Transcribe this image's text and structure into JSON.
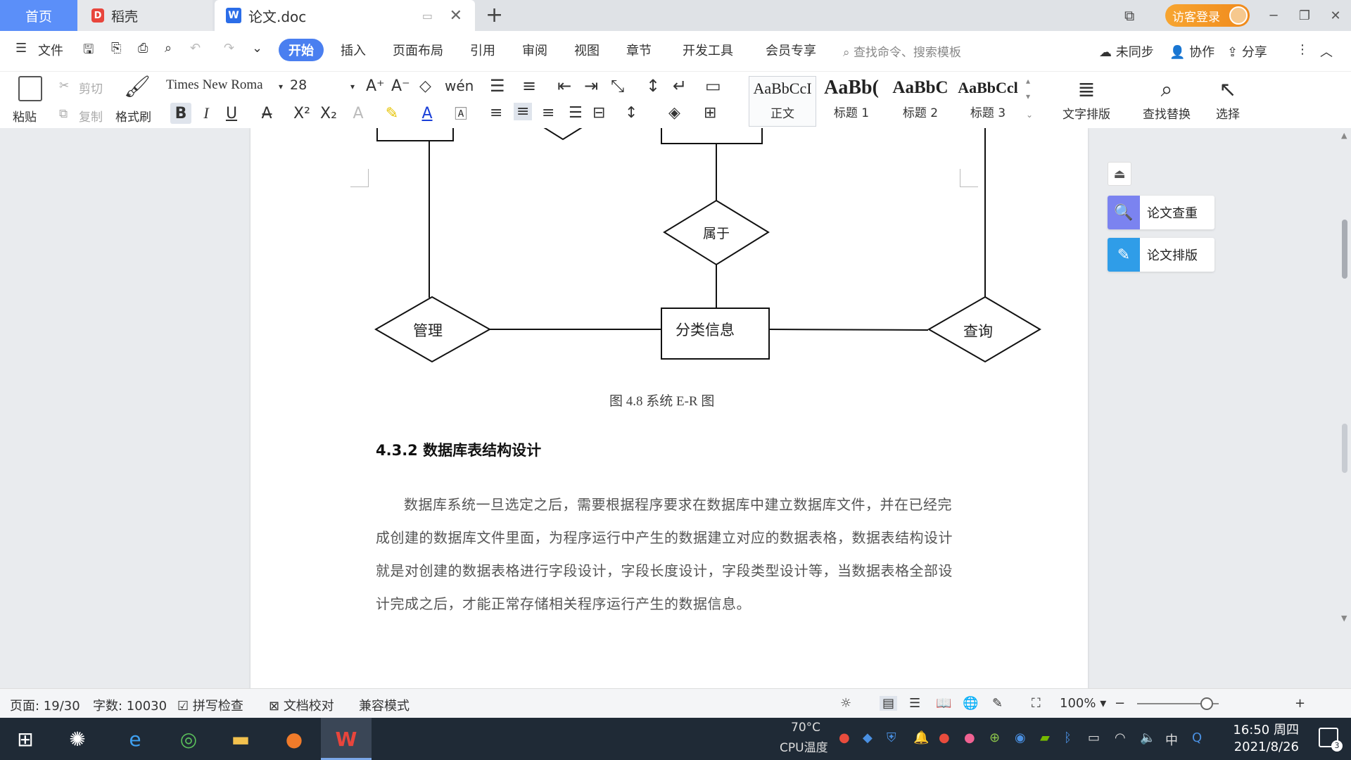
{
  "tabs": {
    "home": "首页",
    "daoke": "稻壳",
    "doc_title": "论文.doc",
    "guest_login": "访客登录"
  },
  "menu": {
    "file": "文件",
    "items": [
      "开始",
      "插入",
      "页面布局",
      "引用",
      "审阅",
      "视图",
      "章节",
      "开发工具",
      "会员专享"
    ],
    "search_placeholder": "查找命令、搜索模板",
    "sync": "未同步",
    "collab": "协作",
    "share": "分享"
  },
  "ribbon": {
    "paste": "粘贴",
    "cut": "剪切",
    "copy": "复制",
    "format_painter": "格式刷",
    "font_name": "Times New Roma",
    "font_size": "28",
    "styles": [
      {
        "sample": "AaBbCcI",
        "label": "正文"
      },
      {
        "sample": "AaBb(",
        "label": "标题 1"
      },
      {
        "sample": "AaBbC",
        "label": "标题 2"
      },
      {
        "sample": "AaBbCcl",
        "label": "标题 3"
      }
    ],
    "text_layout": "文字排版",
    "find_replace": "查找替换",
    "select": "选择"
  },
  "document": {
    "diagram_nodes": {
      "belongs": "属于",
      "manage": "管理",
      "category_info": "分类信息",
      "query": "查询"
    },
    "figure_caption": "图 4.8  系统 E-R 图",
    "section_heading": "4.3.2  数据库表结构设计",
    "paragraph": "数据库系统一旦选定之后，需要根据程序要求在数据库中建立数据库文件，并在已经完成创建的数据库文件里面，为程序运行中产生的数据建立对应的数据表格，数据表结构设计就是对创建的数据表格进行字段设计，字段长度设计，字段类型设计等，当数据表格全部设计完成之后，才能正常存储相关程序运行产生的数据信息。"
  },
  "side_panel": {
    "check": "论文查重",
    "format": "论文排版"
  },
  "status": {
    "page": "页面: 19/30",
    "words": "字数: 10030",
    "spell": "拼写检查",
    "proof": "文档校对",
    "compat": "兼容模式",
    "zoom": "100%"
  },
  "taskbar": {
    "temp": "70°C",
    "temp_label": "CPU温度",
    "ime": "中",
    "time": "16:50 周四",
    "date": "2021/8/26",
    "notif_count": "3"
  }
}
